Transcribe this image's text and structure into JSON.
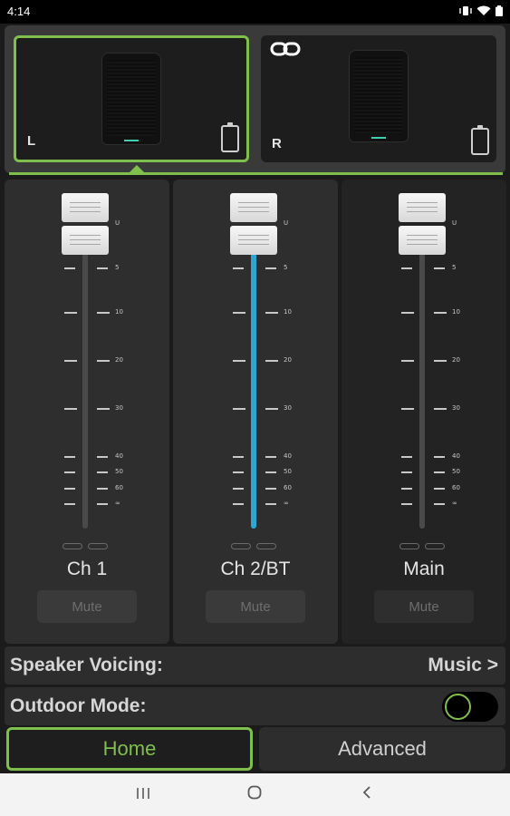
{
  "status_bar": {
    "time": "4:14"
  },
  "speakers": {
    "left": {
      "label": "L"
    },
    "right": {
      "label": "R"
    }
  },
  "channels": [
    {
      "name": "Ch 1",
      "mute_label": "Mute",
      "level_fraction": 0.0
    },
    {
      "name": "Ch 2/BT",
      "mute_label": "Mute",
      "level_fraction": 1.0
    },
    {
      "name": "Main",
      "mute_label": "Mute",
      "level_fraction": 0.0
    }
  ],
  "scale_labels": [
    "U",
    "5",
    "10",
    "20",
    "30",
    "40",
    "50",
    "60",
    "∞"
  ],
  "settings": {
    "speaker_voicing": {
      "label": "Speaker Voicing:",
      "value": "Music >"
    },
    "outdoor_mode": {
      "label": "Outdoor Mode:",
      "enabled": false
    }
  },
  "tabs": {
    "home": "Home",
    "advanced": "Advanced",
    "selected": "Home"
  },
  "colors": {
    "accent": "#7fbf4d",
    "level": "#2aa7d6"
  }
}
